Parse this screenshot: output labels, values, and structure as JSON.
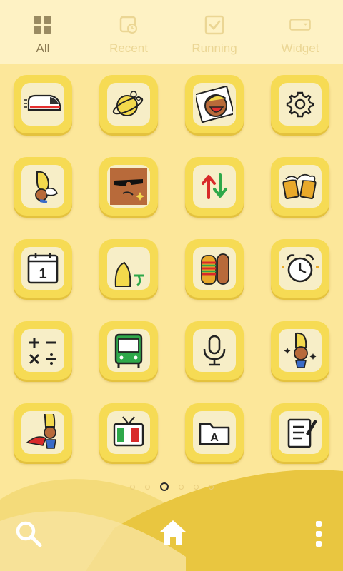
{
  "tabs": [
    {
      "label": "All",
      "icon": "grid-icon",
      "active": true
    },
    {
      "label": "Recent",
      "icon": "recent-icon",
      "active": false
    },
    {
      "label": "Running",
      "icon": "running-icon",
      "active": false
    },
    {
      "label": "Widget",
      "icon": "widget-icon",
      "active": false
    }
  ],
  "apps": [
    {
      "icon": "bullet-train-icon"
    },
    {
      "icon": "planet-icon"
    },
    {
      "icon": "laughing-face-icon"
    },
    {
      "icon": "gear-icon"
    },
    {
      "icon": "banana-character-icon"
    },
    {
      "icon": "sunglasses-face-icon"
    },
    {
      "icon": "up-down-arrows-icon"
    },
    {
      "icon": "beer-mugs-icon"
    },
    {
      "icon": "calendar-icon"
    },
    {
      "icon": "banana-peek-icon"
    },
    {
      "icon": "burger-sandwich-icon"
    },
    {
      "icon": "alarm-clock-icon"
    },
    {
      "icon": "calculator-icon"
    },
    {
      "icon": "bus-icon"
    },
    {
      "icon": "microphone-icon"
    },
    {
      "icon": "banana-sparkle-icon"
    },
    {
      "icon": "banana-superhero-icon"
    },
    {
      "icon": "tv-icon"
    },
    {
      "icon": "folder-a-icon"
    },
    {
      "icon": "notepad-icon"
    }
  ],
  "pager": {
    "count": 6,
    "active": 2
  },
  "colors": {
    "background": "#FCE79A",
    "tab_bar": "#FEF2C4",
    "icon_frame": "#F6DB54",
    "dune": "#E9C640"
  },
  "bottom_bar": [
    "search-icon",
    "home-icon",
    "more-vertical-icon"
  ]
}
